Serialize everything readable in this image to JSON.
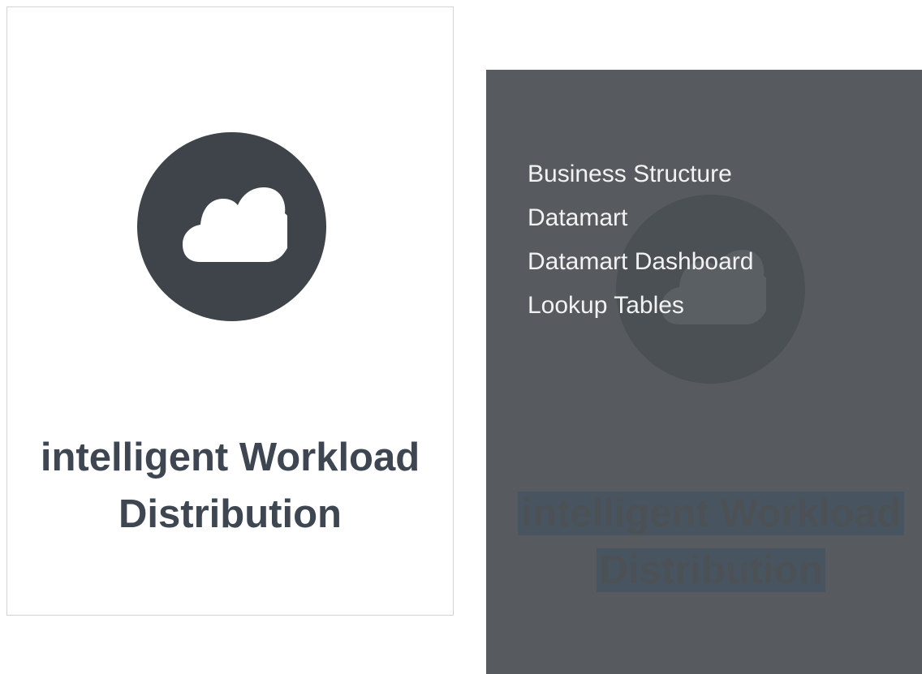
{
  "card": {
    "icon": "cloud-icon",
    "title_line1": "intelligent Workload",
    "title_line2": "Distribution"
  },
  "overlay": {
    "menu": [
      {
        "label": "Business Structure"
      },
      {
        "label": "Datamart"
      },
      {
        "label": "Datamart Dashboard"
      },
      {
        "label": "Lookup Tables"
      }
    ],
    "ghost_title_line1": "intelligent Workload",
    "ghost_title_line2": "Distribution"
  },
  "colors": {
    "card_icon_bg": "#3e444a",
    "title_text": "#3e4651",
    "overlay_bg": "#575b5f",
    "menu_text": "#f2f2f2"
  }
}
